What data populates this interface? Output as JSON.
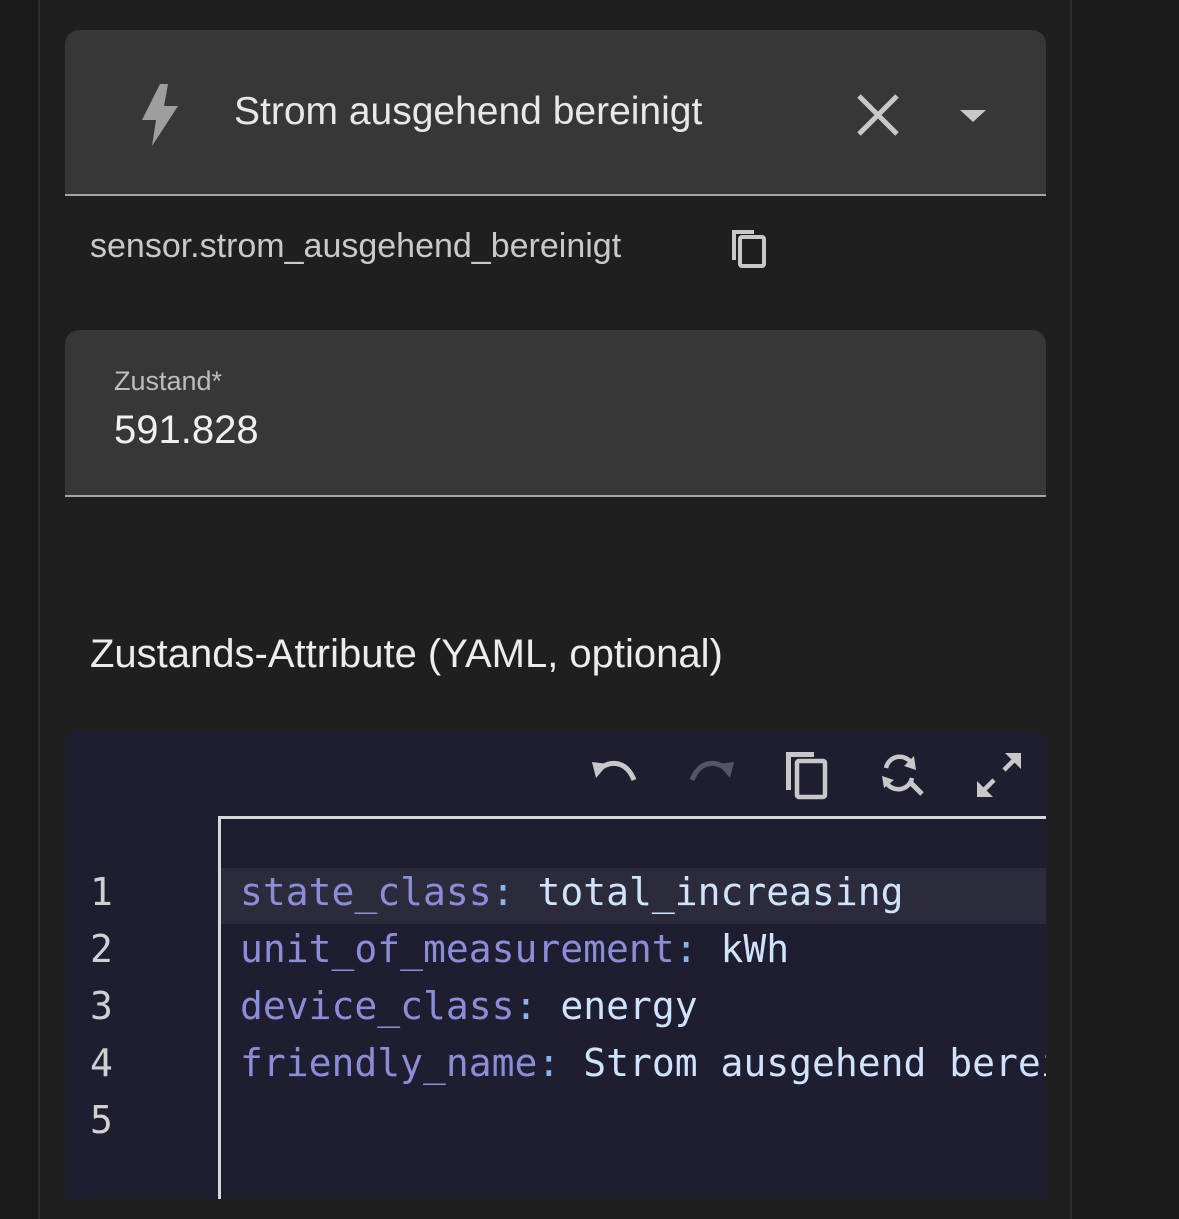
{
  "entity_picker": {
    "icon": "lightning-bolt-icon",
    "name": "Strom ausgehend bereinigt",
    "clear_icon": "close-icon",
    "dropdown_icon": "menu-down-icon"
  },
  "entity_id": {
    "text": "sensor.strom_ausgehend_bereinigt",
    "copy_icon": "content-copy-icon"
  },
  "state_field": {
    "label": "Zustand*",
    "value": "591.828"
  },
  "attributes_title": "Zustands-Attribute (YAML, optional)",
  "editor": {
    "toolbar": [
      "undo-icon",
      "redo-icon",
      "content-copy-icon",
      "find-replace-icon",
      "fullscreen-icon"
    ],
    "line_numbers": [
      "1",
      "2",
      "3",
      "4",
      "5"
    ],
    "lines": [
      {
        "key": "state_class",
        "sep": ":",
        "value": " total_increasing"
      },
      {
        "key": "unit_of_measurement",
        "sep": ":",
        "value": " kWh"
      },
      {
        "key": "device_class",
        "sep": ":",
        "value": " energy"
      },
      {
        "key": "friendly_name",
        "sep": ":",
        "value": " Strom ausgehend bereinigt"
      },
      {
        "key": "",
        "sep": "",
        "value": ""
      }
    ]
  },
  "colors": {
    "background": "#1f1f1f",
    "field_background": "#373737",
    "editor_background": "#1e1e30",
    "yaml_key": "#8c8cd8",
    "yaml_value": "#cfe3ff"
  }
}
